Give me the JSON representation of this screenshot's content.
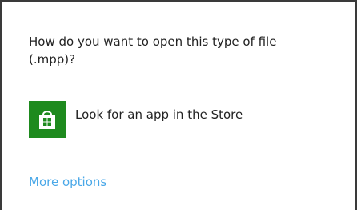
{
  "dialog": {
    "question": "How do you want to open this type of file (.mpp)?",
    "store_option": {
      "label": "Look for an app in the Store",
      "icon": "store-bag-icon",
      "tile_color": "#1e8a1e"
    },
    "more_options_label": "More options",
    "link_color": "#4aa8e8"
  }
}
